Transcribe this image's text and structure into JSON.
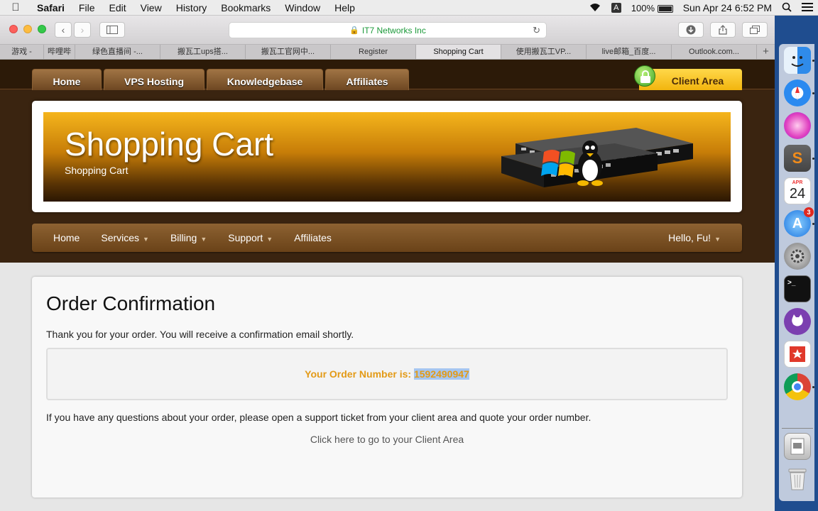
{
  "menubar": {
    "app": "Safari",
    "items": [
      "File",
      "Edit",
      "View",
      "History",
      "Bookmarks",
      "Window",
      "Help"
    ],
    "input_indicator": "A",
    "battery": "100%",
    "clock": "Sun Apr 24  6:52 PM"
  },
  "browser": {
    "address": "IT7 Networks Inc",
    "tabs": [
      {
        "label": "游戏 -"
      },
      {
        "label": "哔哩哔"
      },
      {
        "label": "绿色直播间 -..."
      },
      {
        "label": "搬瓦工ups搭..."
      },
      {
        "label": "搬瓦工官网中..."
      },
      {
        "label": "Register"
      },
      {
        "label": "Shopping Cart"
      },
      {
        "label": "使用搬瓦工VP..."
      },
      {
        "label": "live邮箱_百度..."
      },
      {
        "label": "Outlook.com..."
      }
    ],
    "new_tab": "+"
  },
  "site": {
    "top_tabs": [
      "Home",
      "VPS Hosting",
      "Knowledgebase",
      "Affiliates"
    ],
    "client_area": "Client Area",
    "banner_title": "Shopping Cart",
    "banner_subtitle": "Shopping Cart",
    "nav": {
      "home": "Home",
      "services": "Services",
      "billing": "Billing",
      "support": "Support",
      "affiliates": "Affiliates",
      "hello": "Hello, Fu!"
    }
  },
  "content": {
    "title": "Order Confirmation",
    "thanks": "Thank you for your order. You will receive a confirmation email shortly.",
    "order_label": "Your Order Number is:",
    "order_number": "1592490947",
    "questions": "If you have any questions about your order, please open a support ticket from your client area and quote your order number.",
    "client_link": "Click here to go to your Client Area"
  },
  "dock": {
    "calendar_month": "APR",
    "calendar_day": "24",
    "appstore_badge": "3"
  },
  "colors": {
    "header_brown": "#3a2410",
    "client_area_yellow": "#f2b50e",
    "order_orange": "#e39a16",
    "selection_blue": "#a6c6f0"
  }
}
